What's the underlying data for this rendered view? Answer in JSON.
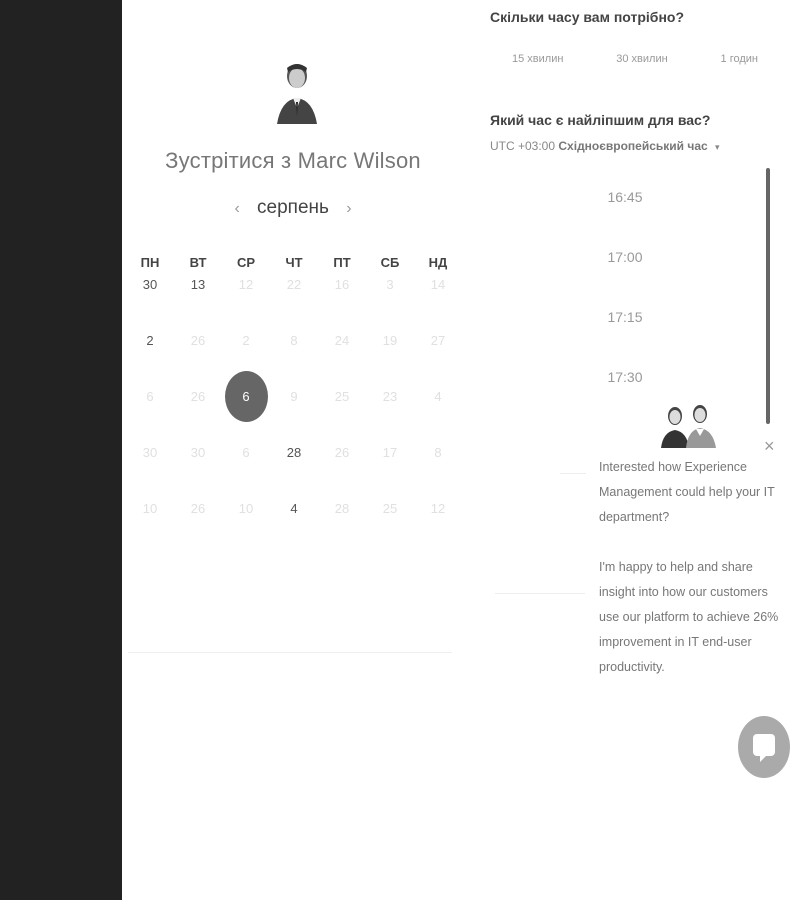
{
  "booking": {
    "host_title": "Зустрітися з Marc Wilson",
    "month": "серпень",
    "prev_arrow": "‹",
    "next_arrow": "›",
    "weekdays": [
      "ПН",
      "ВТ",
      "СР",
      "ЧТ",
      "ПТ",
      "СБ",
      "НД"
    ],
    "weeks": [
      [
        {
          "d": "30",
          "a": true
        },
        {
          "d": "13",
          "a": true
        },
        {
          "d": "12",
          "a": false
        },
        {
          "d": "22",
          "a": false
        },
        {
          "d": "16",
          "a": false
        },
        {
          "d": "3",
          "a": false
        },
        {
          "d": "14",
          "a": false
        }
      ],
      [
        {
          "d": "2",
          "a": true
        },
        {
          "d": "26",
          "a": false
        },
        {
          "d": "2",
          "a": false
        },
        {
          "d": "8",
          "a": false
        },
        {
          "d": "24",
          "a": false
        },
        {
          "d": "19",
          "a": false
        },
        {
          "d": "27",
          "a": false
        }
      ],
      [
        {
          "d": "6",
          "a": false
        },
        {
          "d": "26",
          "a": false
        },
        {
          "d": "6",
          "a": true,
          "selected": true
        },
        {
          "d": "9",
          "a": false
        },
        {
          "d": "25",
          "a": false
        },
        {
          "d": "23",
          "a": false
        },
        {
          "d": "4",
          "a": false
        }
      ],
      [
        {
          "d": "30",
          "a": false
        },
        {
          "d": "30",
          "a": false
        },
        {
          "d": "6",
          "a": false
        },
        {
          "d": "28",
          "a": true
        },
        {
          "d": "26",
          "a": false
        },
        {
          "d": "17",
          "a": false
        },
        {
          "d": "8",
          "a": false
        }
      ],
      [
        {
          "d": "10",
          "a": false
        },
        {
          "d": "26",
          "a": false
        },
        {
          "d": "10",
          "a": false
        },
        {
          "d": "4",
          "a": true
        },
        {
          "d": "28",
          "a": false
        },
        {
          "d": "25",
          "a": false
        },
        {
          "d": "12",
          "a": false
        }
      ]
    ]
  },
  "duration": {
    "question": "Скільки часу вам потрібно?",
    "options": [
      "15 хвилин",
      "30 хвилин",
      "1 годин"
    ]
  },
  "time": {
    "question": "Який час є найліпшим для вас?",
    "tz_offset": "UTC +03:00",
    "tz_name": "Східноєвропейський час",
    "tz_caret": "▾",
    "slots": [
      "16:45",
      "17:00",
      "17:15",
      "17:30"
    ]
  },
  "chat": {
    "message_1": "Interested how Experience Management could help your IT department?",
    "message_2": "I'm happy to help and share insight into how our customers use our platform to achieve 26% improvement in IT end-user productivity.",
    "close_icon": "×"
  },
  "colors": {
    "sidebar": "#222222",
    "selected_day": "#666666"
  }
}
